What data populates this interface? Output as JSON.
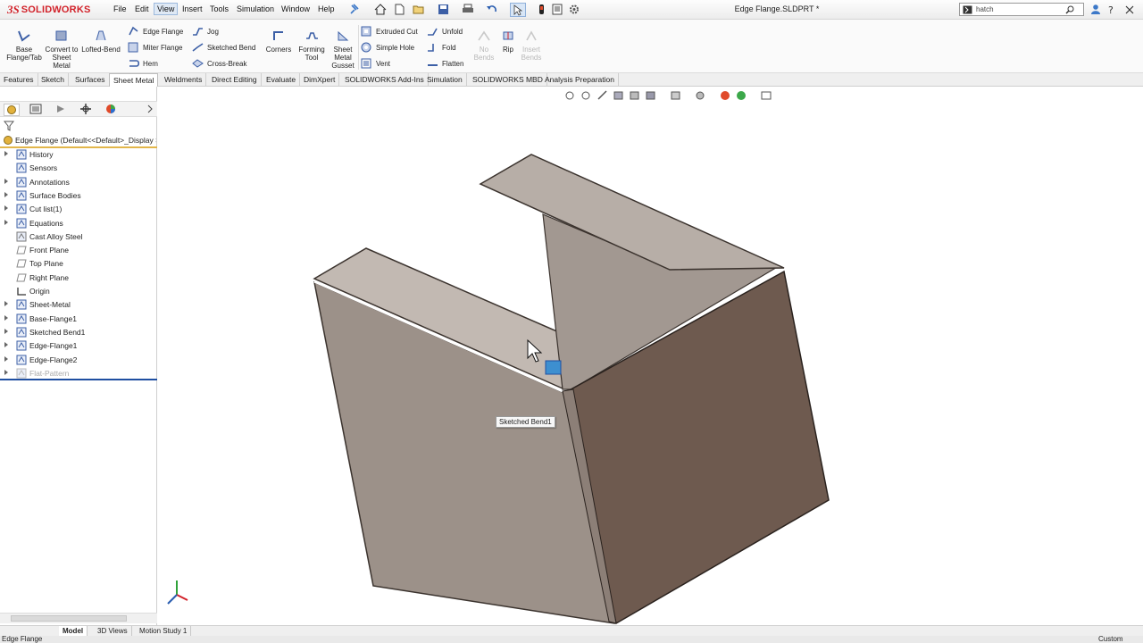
{
  "app": {
    "logo_prefix": "3S",
    "logo_name": "SOLIDWORKS",
    "document_title": "Edge Flange.SLDPRT *"
  },
  "menu": [
    {
      "label": "File"
    },
    {
      "label": "Edit"
    },
    {
      "label": "View",
      "active": true
    },
    {
      "label": "Insert"
    },
    {
      "label": "Tools"
    },
    {
      "label": "Simulation"
    },
    {
      "label": "Window"
    },
    {
      "label": "Help"
    }
  ],
  "search": {
    "value": "hatch"
  },
  "ribbon": {
    "base_flange": "Base Flange/Tab",
    "convert": "Convert to Sheet Metal",
    "lofted_bend": "Lofted-Bend",
    "edge_flange": "Edge Flange",
    "miter_flange": "Miter Flange",
    "hem": "Hem",
    "jog": "Jog",
    "sketched_bend": "Sketched Bend",
    "cross_break": "Cross-Break",
    "corners": "Corners",
    "forming_tool": "Forming Tool",
    "gusset": "Sheet Metal Gusset",
    "extruded_cut": "Extruded Cut",
    "simple_hole": "Simple Hole",
    "vent": "Vent",
    "unfold": "Unfold",
    "fold": "Fold",
    "flatten": "Flatten",
    "no_bends": "No Bends",
    "rip": "Rip",
    "insert_bends": "Insert Bends"
  },
  "command_tabs": [
    {
      "label": "Features"
    },
    {
      "label": "Sketch"
    },
    {
      "label": "Surfaces"
    },
    {
      "label": "Sheet Metal",
      "active": true
    },
    {
      "label": "Weldments"
    },
    {
      "label": "Direct Editing"
    },
    {
      "label": "Evaluate"
    },
    {
      "label": "DimXpert"
    },
    {
      "label": "SOLIDWORKS Add-Ins"
    },
    {
      "label": "Simulation"
    },
    {
      "label": "SOLIDWORKS MBD"
    },
    {
      "label": "Analysis Preparation"
    }
  ],
  "tree": {
    "root": "Edge Flange  (Default<<Default>_Display S",
    "items": [
      {
        "label": "History",
        "icon": "history-icon"
      },
      {
        "label": "Sensors",
        "icon": "sensors-icon"
      },
      {
        "label": "Annotations",
        "icon": "annotations-icon"
      },
      {
        "label": "Surface Bodies",
        "icon": "surface-bodies-icon"
      },
      {
        "label": "Cut list(1)",
        "icon": "cut-list-icon"
      },
      {
        "label": "Equations",
        "icon": "equations-icon"
      },
      {
        "label": "Cast Alloy Steel",
        "icon": "material-icon"
      },
      {
        "label": "Front Plane",
        "icon": "plane-icon"
      },
      {
        "label": "Top Plane",
        "icon": "plane-icon"
      },
      {
        "label": "Right Plane",
        "icon": "plane-icon"
      },
      {
        "label": "Origin",
        "icon": "origin-icon"
      },
      {
        "label": "Sheet-Metal",
        "icon": "sheet-metal-icon"
      },
      {
        "label": "Base-Flange1",
        "icon": "base-flange-icon"
      },
      {
        "label": "Sketched Bend1",
        "icon": "sketched-bend-icon"
      },
      {
        "label": "Edge-Flange1",
        "icon": "edge-flange-icon"
      },
      {
        "label": "Edge-Flange2",
        "icon": "edge-flange-icon"
      },
      {
        "label": "Flat-Pattern",
        "icon": "flat-pattern-icon"
      }
    ]
  },
  "viewport": {
    "tooltip": "Sketched Bend1"
  },
  "bottom_tabs": [
    {
      "label": "Model",
      "active": true
    },
    {
      "label": "3D Views"
    },
    {
      "label": "Motion Study 1"
    }
  ],
  "status": {
    "left": "Edge Flange",
    "right": "Custom"
  },
  "colors": {
    "accent_red": "#d2222a",
    "selection_blue": "#1f4fa1",
    "part_light": "#9c9189",
    "part_dark": "#6e5a4f"
  }
}
